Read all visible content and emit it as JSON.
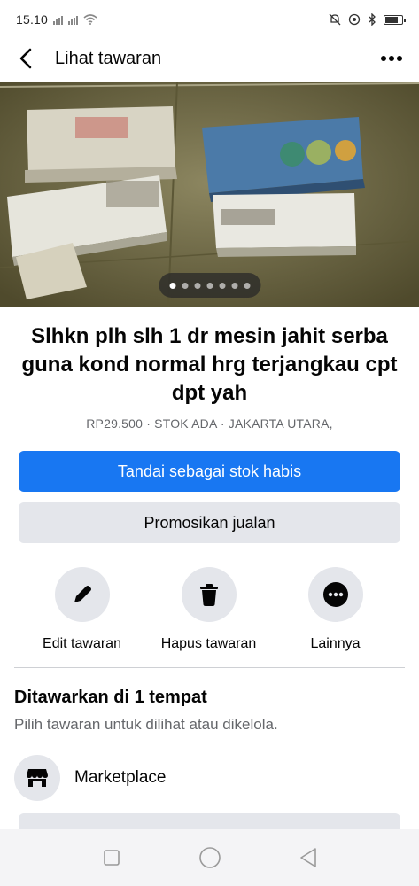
{
  "status_bar": {
    "time": "15.10",
    "battery_level": 0.8
  },
  "app_bar": {
    "title": "Lihat tawaran",
    "back_icon": "back-arrow-icon",
    "more_icon": "more-horizontal-icon"
  },
  "photo": {
    "total_images": 7,
    "active_index": 0
  },
  "listing": {
    "title": "Slhkn plh slh 1 dr mesin jahit serba guna kond normal hrg terjangkau cpt dpt yah",
    "meta": "RP29.500 · STOK ADA · JAKARTA UTARA,"
  },
  "buttons": {
    "mark_sold": "Tandai sebagai stok habis",
    "promote": "Promosikan jualan"
  },
  "actions": [
    {
      "label": "Edit tawaran",
      "icon": "pencil-icon"
    },
    {
      "label": "Hapus tawaran",
      "icon": "trash-icon"
    },
    {
      "label": "Lainnya",
      "icon": "more-icon"
    }
  ],
  "offered": {
    "title": "Ditawarkan di 1 tempat",
    "subtitle": "Pilih tawaran untuk dilihat atau dikelola.",
    "places": [
      {
        "label": "Marketplace",
        "icon": "marketplace-shop-icon"
      }
    ]
  },
  "colors": {
    "primary": "#1877f2",
    "secondary_bg": "#e4e6eb",
    "text": "#050505",
    "muted": "#65676b"
  }
}
